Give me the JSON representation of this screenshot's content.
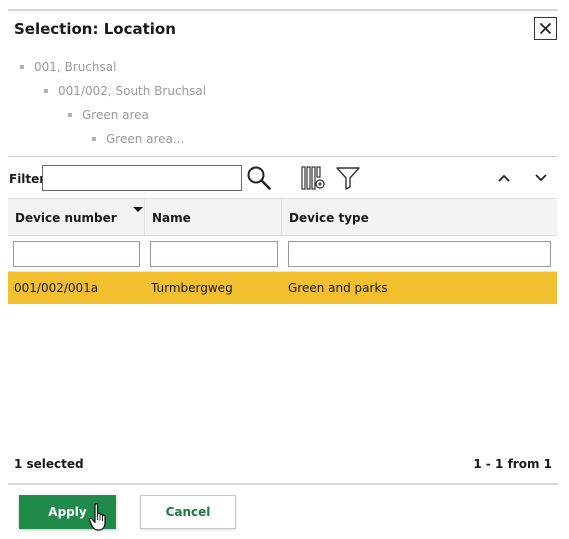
{
  "dialog": {
    "title": "Selection: Location",
    "close_icon": "close-icon"
  },
  "location_tree": {
    "items": [
      {
        "label": "001, Bruchsal",
        "level": 0
      },
      {
        "label": "001/002, South Bruchsal",
        "level": 1
      },
      {
        "label": "Green area",
        "level": 2
      },
      {
        "label": "Green area...",
        "level": 3
      }
    ]
  },
  "toolbar": {
    "filter_label": "Filter",
    "filter_value": "",
    "search_icon": "search-icon",
    "column_settings_icon": "column-settings-icon",
    "filter_icon": "funnel-icon",
    "collapse_icon": "chevron-up-icon",
    "expand_icon": "chevron-down-icon"
  },
  "grid": {
    "columns": [
      {
        "label": "Device number",
        "sorted": true
      },
      {
        "label": "Name",
        "sorted": false
      },
      {
        "label": "Device type",
        "sorted": false
      }
    ],
    "rows": [
      {
        "device_number": "001/002/001a",
        "name": "Turmbergweg",
        "device_type": "Green and parks",
        "selected": true
      }
    ],
    "selected_row_color": "#f2bf2f"
  },
  "status": {
    "selected_count": "1 selected",
    "pagination": "1 - 1 from 1"
  },
  "actions": {
    "apply_label": "Apply",
    "cancel_label": "Cancel",
    "apply_color": "#1f8a4a",
    "cancel_color": "#1f7a3f"
  }
}
